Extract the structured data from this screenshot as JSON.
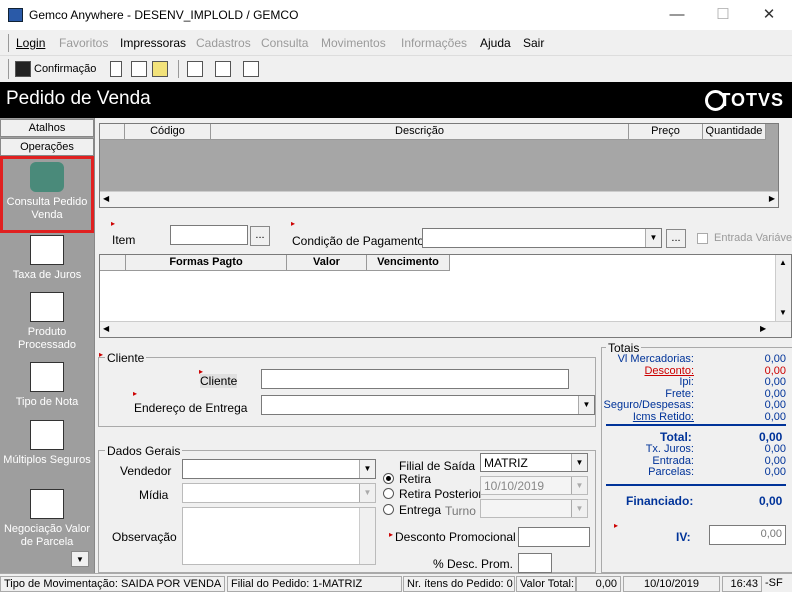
{
  "window": {
    "title": "Gemco Anywhere - DESENV_IMPLOLD / GEMCO",
    "minimize": "—",
    "maximize": "☐",
    "close": "✕"
  },
  "menu": {
    "items": [
      "Login",
      "Favoritos",
      "Impressoras",
      "Cadastros",
      "Consulta",
      "Movimentos",
      "Informações",
      "Ajuda",
      "Sair"
    ]
  },
  "toolbar": {
    "confirm_label": "Confirmação"
  },
  "header": {
    "title": "Pedido de Venda",
    "logo": "TOTVS"
  },
  "sidebar": {
    "tabs": [
      "Atalhos",
      "Operações"
    ],
    "items": [
      "Consulta Pedido Venda",
      "Taxa de Juros",
      "Produto Processado",
      "Tipo de Nota",
      "Múltiplos Seguros",
      "Negociação Valor de Parcela"
    ],
    "scroll_down": "▼"
  },
  "items_grid": {
    "columns": [
      "Código",
      "Descrição",
      "Preço",
      "Quantidade"
    ]
  },
  "scroll": {
    "left": "◀",
    "right": "▶",
    "up": "▲",
    "down": "▼"
  },
  "item_field": {
    "label": "Item",
    "dots": "..."
  },
  "payment_cond": {
    "label": "Condição de Pagamento",
    "dots": "...",
    "checkbox_label": "Entrada Variável"
  },
  "payment_grid": {
    "columns": [
      "Formas Pagto",
      "Valor",
      "Vencimento"
    ]
  },
  "cliente": {
    "group_title": "Cliente",
    "cliente_label": "Cliente",
    "endereco_label": "Endereço de Entrega"
  },
  "dados_gerais": {
    "group_title": "Dados Gerais",
    "vendedor_label": "Vendedor",
    "midia_label": "Mídia",
    "observacao_label": "Observação",
    "filial_label": "Filial de Saída",
    "filial_value": "MATRIZ",
    "retira_label": "Retira",
    "retira_posterior_label": "Retira Posterior",
    "retira_posterior_date": "10/10/2019",
    "entrega_label": "Entrega",
    "turno_label": "Turno",
    "desconto_promocional_label": "Desconto Promocional",
    "pct_desc_prom_label": "% Desc. Prom."
  },
  "totais": {
    "group_title": "Totais",
    "rows": [
      {
        "label": "Vl Mercadorias:",
        "value": "0,00"
      },
      {
        "label": "Desconto:",
        "value": "0,00"
      },
      {
        "label": "Ipi:",
        "value": "0,00"
      },
      {
        "label": "Frete:",
        "value": "0,00"
      },
      {
        "label": "Seguro/Despesas:",
        "value": "0,00"
      },
      {
        "label": "Icms Retido:",
        "value": "0,00"
      }
    ],
    "total_label": "Total:",
    "total_value": "0,00",
    "rows2": [
      {
        "label": "Tx. Juros:",
        "value": "0,00"
      },
      {
        "label": "Entrada:",
        "value": "0,00"
      },
      {
        "label": "Parcelas:",
        "value": "0,00"
      }
    ],
    "financiado_label": "Financiado:",
    "financiado_value": "0,00",
    "iv_label": "IV:",
    "iv_value": "0,00"
  },
  "status": {
    "tipo_mov": "Tipo de Movimentação: SAIDA POR VENDA",
    "filial": "Filial do Pedido: 1-MATRIZ",
    "nr_itens": "Nr. ítens do Pedido: 0",
    "valor_total_label": "Valor Total:",
    "valor_total": "0,00",
    "date": "10/10/2019",
    "time": "16:43",
    "extra": "-SF"
  },
  "colors": {
    "header_bg": "#000000",
    "sidebar_bg": "#9e9e9e",
    "highlight": "#e02020",
    "totals_text": "#003399",
    "discount": "#cc0000"
  }
}
